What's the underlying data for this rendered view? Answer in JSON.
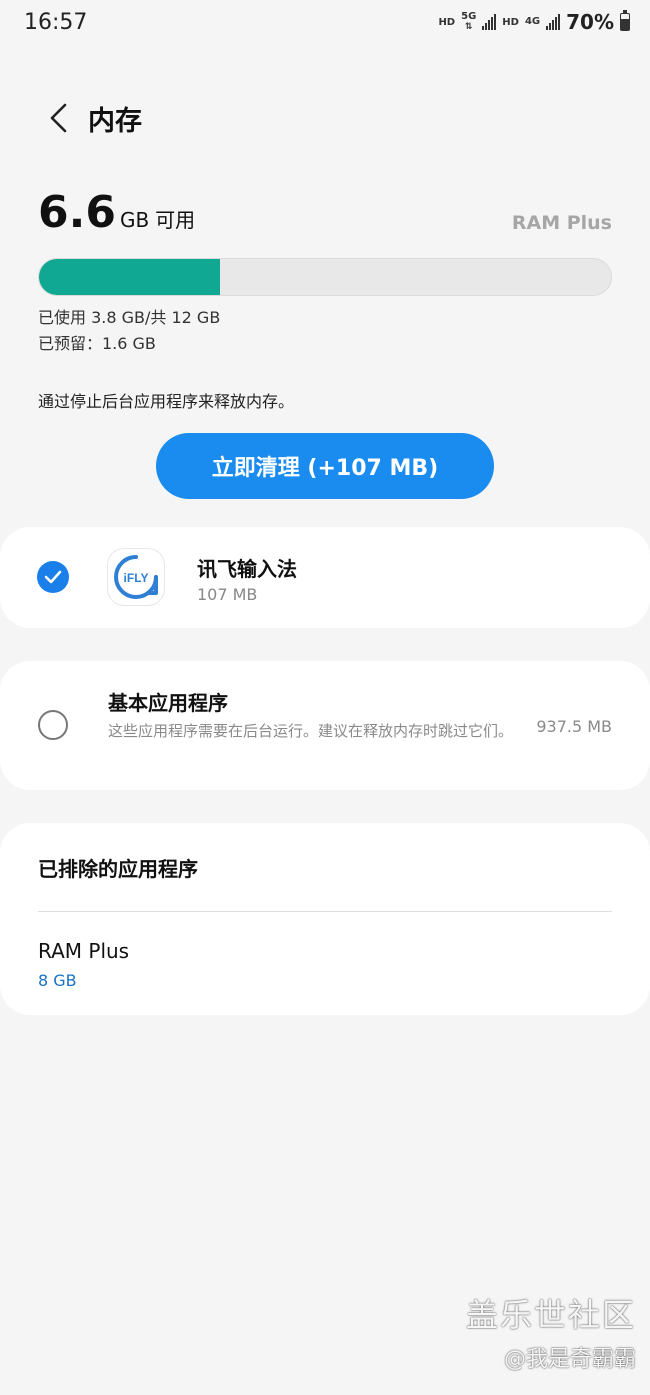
{
  "status_bar": {
    "time": "16:57",
    "hd1": "HD",
    "net1": "5G",
    "hd2": "HD",
    "net2": "4G",
    "battery": "70%",
    "battery_level": 0.7
  },
  "header": {
    "title": "内存"
  },
  "memory": {
    "available_value": "6.6",
    "available_unit": "GB",
    "available_label": "可用",
    "ram_plus_link": "RAM Plus",
    "used_fraction": 0.3167,
    "used_text": "已使用 3.8 GB/共 12 GB",
    "reserved_text": "已预留：1.6 GB"
  },
  "hint": "通过停止后台应用程序来释放内存。",
  "clean_button": "立即清理 (+107 MB)",
  "apps": [
    {
      "name": "讯飞输入法",
      "size": "107 MB",
      "checked": true,
      "icon_text": "iFLY"
    }
  ],
  "basic_apps": {
    "name": "基本应用程序",
    "description": "这些应用程序需要在后台运行。建议在释放内存时跳过它们。",
    "size": "937.5 MB",
    "checked": false
  },
  "excluded": {
    "title": "已排除的应用程序",
    "item_name": "RAM Plus",
    "item_value": "8 GB"
  },
  "watermark": {
    "line1": "盖乐世社区",
    "line2": "@我是奇霸霸"
  },
  "colors": {
    "accent": "#1a8cf0",
    "progress_fill": "#10a892",
    "link_blue": "#1b72c4"
  }
}
